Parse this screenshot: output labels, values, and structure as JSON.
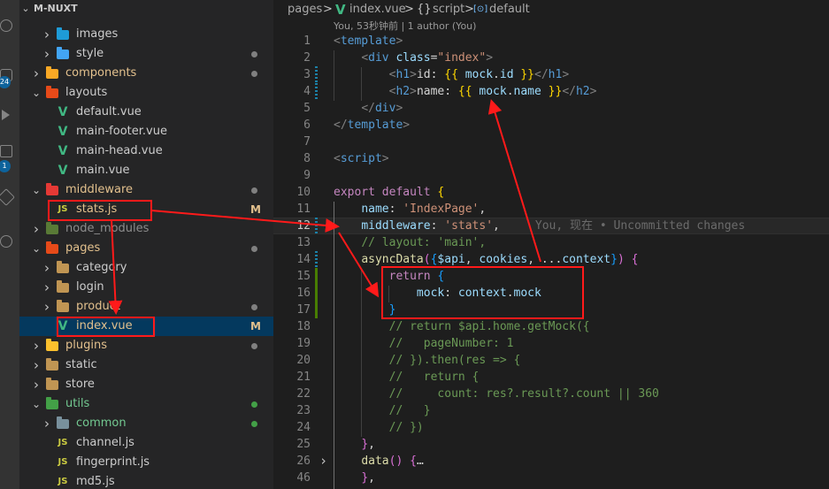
{
  "explorer": {
    "section_title": "M-NUXT",
    "items": [
      {
        "label": "images",
        "kind": "folder",
        "expanded": false,
        "indent": 1,
        "color": "#1e9bd7",
        "dot": false
      },
      {
        "label": "style",
        "kind": "folder",
        "expanded": false,
        "indent": 1,
        "color": "#42a5f5",
        "dot": true,
        "dot_color": "#808080"
      },
      {
        "label": "components",
        "kind": "folder",
        "expanded": false,
        "indent": 0,
        "color": "#f9a825",
        "dot": true,
        "dot_color": "#808080",
        "label_color": "#e2c08d"
      },
      {
        "label": "layouts",
        "kind": "folder",
        "expanded": true,
        "indent": 0,
        "color": "#e64a19"
      },
      {
        "label": "default.vue",
        "kind": "vue",
        "indent": 1
      },
      {
        "label": "main-footer.vue",
        "kind": "vue",
        "indent": 1
      },
      {
        "label": "main-head.vue",
        "kind": "vue",
        "indent": 1
      },
      {
        "label": "main.vue",
        "kind": "vue",
        "indent": 1
      },
      {
        "label": "middleware",
        "kind": "folder",
        "expanded": true,
        "indent": 0,
        "color": "#e53935",
        "dot": true,
        "dot_color": "#808080",
        "label_color": "#e2c08d"
      },
      {
        "label": "stats.js",
        "kind": "js",
        "indent": 1,
        "badge": "M",
        "label_color": "#e2c08d"
      },
      {
        "label": "node_modules",
        "kind": "folder",
        "expanded": false,
        "indent": 0,
        "color": "#7cb342",
        "dim": true
      },
      {
        "label": "pages",
        "kind": "folder",
        "expanded": true,
        "indent": 0,
        "color": "#e64a19",
        "dot": true,
        "dot_color": "#808080",
        "label_color": "#e2c08d"
      },
      {
        "label": "category",
        "kind": "folder",
        "expanded": false,
        "indent": 1,
        "color": "#c09553"
      },
      {
        "label": "login",
        "kind": "folder",
        "expanded": false,
        "indent": 1,
        "color": "#c09553"
      },
      {
        "label": "product",
        "kind": "folder",
        "expanded": false,
        "indent": 1,
        "color": "#c09553",
        "dot": true,
        "dot_color": "#808080",
        "label_color": "#e2c08d"
      },
      {
        "label": "index.vue",
        "kind": "vue",
        "indent": 1,
        "badge": "M",
        "label_color": "#e2c08d",
        "active": true
      },
      {
        "label": "plugins",
        "kind": "folder",
        "expanded": false,
        "indent": 0,
        "color": "#fbc02d",
        "dot": true,
        "dot_color": "#808080",
        "label_color": "#e2c08d"
      },
      {
        "label": "static",
        "kind": "folder",
        "expanded": false,
        "indent": 0,
        "color": "#c09553"
      },
      {
        "label": "store",
        "kind": "folder",
        "expanded": false,
        "indent": 0,
        "color": "#c09553"
      },
      {
        "label": "utils",
        "kind": "folder",
        "expanded": true,
        "indent": 0,
        "color": "#43a047",
        "dot": true,
        "dot_color": "#43a047",
        "label_color": "#73c991"
      },
      {
        "label": "common",
        "kind": "folder",
        "expanded": false,
        "indent": 1,
        "color": "#78909c",
        "dot": true,
        "dot_color": "#43a047",
        "label_color": "#73c991"
      },
      {
        "label": "channel.js",
        "kind": "js",
        "indent": 1
      },
      {
        "label": "fingerprint.js",
        "kind": "js",
        "indent": 1
      },
      {
        "label": "md5.js",
        "kind": "js",
        "indent": 1
      }
    ]
  },
  "activity_badges": [
    "24",
    "1"
  ],
  "breadcrumb": {
    "pages": "pages",
    "sep1": ">",
    "file": "index.vue",
    "sep2": ">",
    "braces": "{}",
    "script": "script",
    "sep3": ">",
    "default_icon": "[⊙]",
    "default": "default"
  },
  "codelens": "You, 53秒钟前 | 1 author (You)",
  "blame": "You, 现在 • Uncommitted changes",
  "lines": [
    {
      "n": "1",
      "tokens": [
        [
          "t-punct",
          "<"
        ],
        [
          "t-tag",
          "template"
        ],
        [
          "t-punct",
          ">"
        ]
      ]
    },
    {
      "n": "2",
      "tokens": [
        [
          "t-text",
          "    "
        ],
        [
          "t-punct",
          "<"
        ],
        [
          "t-tag",
          "div"
        ],
        [
          "t-text",
          " "
        ],
        [
          "t-attr",
          "class"
        ],
        [
          "t-text",
          "="
        ],
        [
          "t-str",
          "\"index\""
        ],
        [
          "t-punct",
          ">"
        ]
      ]
    },
    {
      "n": "3",
      "tokens": [
        [
          "t-text",
          "        "
        ],
        [
          "t-punct",
          "<"
        ],
        [
          "t-tag",
          "h1"
        ],
        [
          "t-punct",
          ">"
        ],
        [
          "t-text",
          "id: "
        ],
        [
          "t-brace",
          "{{"
        ],
        [
          "t-text",
          " "
        ],
        [
          "t-var",
          "mock"
        ],
        [
          "t-text",
          "."
        ],
        [
          "t-var",
          "id"
        ],
        [
          "t-text",
          " "
        ],
        [
          "t-brace",
          "}}"
        ],
        [
          "t-punct",
          "</"
        ],
        [
          "t-tag",
          "h1"
        ],
        [
          "t-punct",
          ">"
        ]
      ]
    },
    {
      "n": "4",
      "tokens": [
        [
          "t-text",
          "        "
        ],
        [
          "t-punct",
          "<"
        ],
        [
          "t-tag",
          "h2"
        ],
        [
          "t-punct",
          ">"
        ],
        [
          "t-text",
          "name: "
        ],
        [
          "t-brace",
          "{{"
        ],
        [
          "t-text",
          " "
        ],
        [
          "t-var",
          "mock"
        ],
        [
          "t-text",
          "."
        ],
        [
          "t-var",
          "name"
        ],
        [
          "t-text",
          " "
        ],
        [
          "t-brace",
          "}}"
        ],
        [
          "t-punct",
          "</"
        ],
        [
          "t-tag",
          "h2"
        ],
        [
          "t-punct",
          ">"
        ]
      ]
    },
    {
      "n": "5",
      "tokens": [
        [
          "t-text",
          "    "
        ],
        [
          "t-punct",
          "</"
        ],
        [
          "t-tag",
          "div"
        ],
        [
          "t-punct",
          ">"
        ]
      ]
    },
    {
      "n": "6",
      "tokens": [
        [
          "t-punct",
          "</"
        ],
        [
          "t-tag",
          "template"
        ],
        [
          "t-punct",
          ">"
        ]
      ]
    },
    {
      "n": "7",
      "tokens": []
    },
    {
      "n": "8",
      "tokens": [
        [
          "t-punct",
          "<"
        ],
        [
          "t-tag",
          "script"
        ],
        [
          "t-punct",
          ">"
        ]
      ]
    },
    {
      "n": "9",
      "tokens": []
    },
    {
      "n": "10",
      "tokens": [
        [
          "t-kw",
          "export"
        ],
        [
          "t-text",
          " "
        ],
        [
          "t-kw",
          "default"
        ],
        [
          "t-text",
          " "
        ],
        [
          "t-brace",
          "{"
        ]
      ]
    },
    {
      "n": "11",
      "tokens": [
        [
          "t-text",
          "    "
        ],
        [
          "t-var",
          "name"
        ],
        [
          "t-text",
          ": "
        ],
        [
          "t-str",
          "'IndexPage'"
        ],
        [
          "t-text",
          ","
        ]
      ]
    },
    {
      "n": "12",
      "tokens": [
        [
          "t-text",
          "    "
        ],
        [
          "t-var",
          "middleware"
        ],
        [
          "t-text",
          ": "
        ],
        [
          "t-str",
          "'stats'"
        ],
        [
          "t-text",
          ","
        ]
      ],
      "current": true
    },
    {
      "n": "13",
      "tokens": [
        [
          "t-text",
          "    "
        ],
        [
          "t-com",
          "// layout: 'main',"
        ]
      ]
    },
    {
      "n": "14",
      "tokens": [
        [
          "t-text",
          "    "
        ],
        [
          "t-fn",
          "asyncData"
        ],
        [
          "t-brace2",
          "("
        ],
        [
          "t-brace3",
          "{"
        ],
        [
          "t-var",
          "$api"
        ],
        [
          "t-text",
          ", "
        ],
        [
          "t-var",
          "cookies"
        ],
        [
          "t-text",
          ", ..."
        ],
        [
          "t-var",
          "context"
        ],
        [
          "t-brace3",
          "}"
        ],
        [
          "t-brace2",
          ")"
        ],
        [
          "t-text",
          " "
        ],
        [
          "t-brace2",
          "{"
        ]
      ]
    },
    {
      "n": "15",
      "tokens": [
        [
          "t-text",
          "        "
        ],
        [
          "t-kw",
          "return"
        ],
        [
          "t-text",
          " "
        ],
        [
          "t-brace3",
          "{"
        ]
      ]
    },
    {
      "n": "16",
      "tokens": [
        [
          "t-text",
          "            "
        ],
        [
          "t-var",
          "mock"
        ],
        [
          "t-text",
          ": "
        ],
        [
          "t-var",
          "context"
        ],
        [
          "t-text",
          "."
        ],
        [
          "t-var",
          "mock"
        ]
      ]
    },
    {
      "n": "17",
      "tokens": [
        [
          "t-text",
          "        "
        ],
        [
          "t-brace3",
          "}"
        ]
      ]
    },
    {
      "n": "18",
      "tokens": [
        [
          "t-text",
          "        "
        ],
        [
          "t-com",
          "// return $api.home.getMock({"
        ]
      ]
    },
    {
      "n": "19",
      "tokens": [
        [
          "t-text",
          "        "
        ],
        [
          "t-com",
          "//   pageNumber: 1"
        ]
      ]
    },
    {
      "n": "20",
      "tokens": [
        [
          "t-text",
          "        "
        ],
        [
          "t-com",
          "// }).then(res => {"
        ]
      ]
    },
    {
      "n": "21",
      "tokens": [
        [
          "t-text",
          "        "
        ],
        [
          "t-com",
          "//   return {"
        ]
      ]
    },
    {
      "n": "22",
      "tokens": [
        [
          "t-text",
          "        "
        ],
        [
          "t-com",
          "//     count: res?.result?.count || 360"
        ]
      ]
    },
    {
      "n": "23",
      "tokens": [
        [
          "t-text",
          "        "
        ],
        [
          "t-com",
          "//   }"
        ]
      ]
    },
    {
      "n": "24",
      "tokens": [
        [
          "t-text",
          "        "
        ],
        [
          "t-com",
          "// })"
        ]
      ]
    },
    {
      "n": "25",
      "tokens": [
        [
          "t-text",
          "    "
        ],
        [
          "t-brace2",
          "}"
        ],
        [
          "t-text",
          ","
        ]
      ]
    },
    {
      "n": "26",
      "tokens": [
        [
          "t-text",
          "    "
        ],
        [
          "t-fn",
          "data"
        ],
        [
          "t-brace2",
          "()"
        ],
        [
          "t-text",
          " "
        ],
        [
          "t-brace2",
          "{"
        ],
        [
          "t-text",
          "…"
        ]
      ],
      "folded": true
    },
    {
      "n": "46",
      "tokens": [
        [
          "t-text",
          "    "
        ],
        [
          "t-brace2",
          "}"
        ],
        [
          "t-text",
          ","
        ]
      ]
    }
  ]
}
